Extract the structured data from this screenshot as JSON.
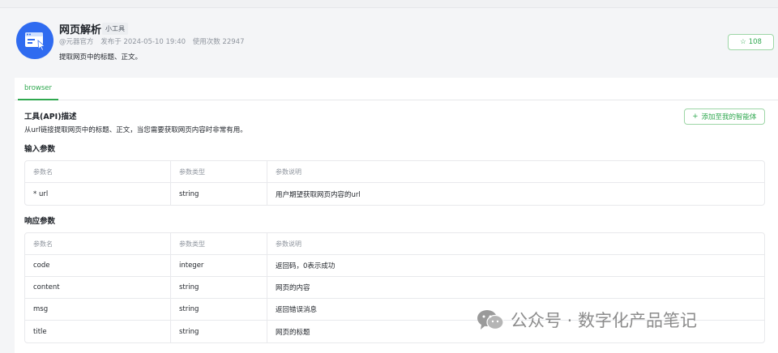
{
  "tool": {
    "name": "网页解析",
    "tag": "小工具",
    "author": "@元器官方",
    "published": "发布于 2024-05-10 19:40",
    "usage": "使用次数 22947",
    "description": "提取网页中的标题、正文。",
    "favorites": "108"
  },
  "tabs": [
    {
      "label": "browser"
    }
  ],
  "api": {
    "section_title": "工具(API)描述",
    "description": "从url链接提取网页中的标题、正文，当您需要获取网页内容时非常有用。",
    "add_button": "添加至我的智能体"
  },
  "input_params": {
    "title": "输入参数",
    "headers": [
      "参数名",
      "参数类型",
      "参数说明"
    ],
    "rows": [
      {
        "name": "* url",
        "type": "string",
        "desc": "用户期望获取网页内容的url"
      }
    ]
  },
  "response_params": {
    "title": "响应参数",
    "headers": [
      "参数名",
      "参数类型",
      "参数说明"
    ],
    "rows": [
      {
        "name": "code",
        "type": "integer",
        "desc": "返回码，0表示成功"
      },
      {
        "name": "content",
        "type": "string",
        "desc": "网页的内容"
      },
      {
        "name": "msg",
        "type": "string",
        "desc": "返回错误消息"
      },
      {
        "name": "title",
        "type": "string",
        "desc": "网页的标题"
      }
    ]
  },
  "watermark": {
    "text": "公众号 · 数字化产品笔记",
    "icon": "wechat-icon"
  },
  "colors": {
    "brand_blue": "#2f6bf0",
    "accent_green": "#2fa84f"
  }
}
